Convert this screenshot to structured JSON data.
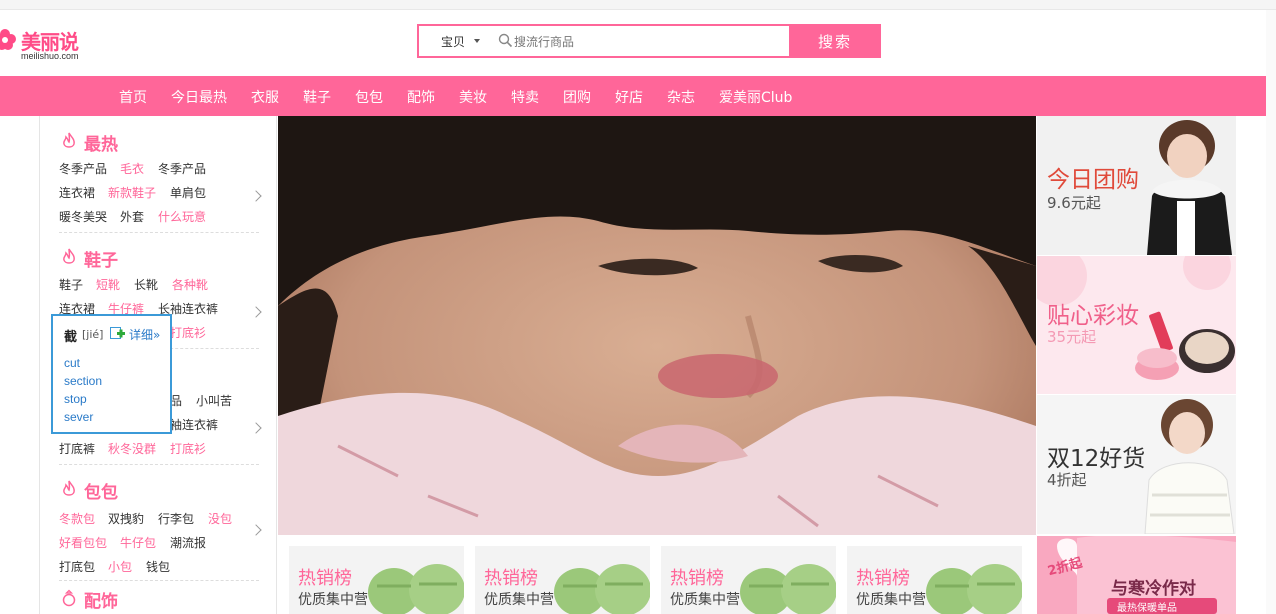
{
  "logo": {
    "name": "美丽说",
    "domain": "meilishuo.com"
  },
  "search": {
    "type_label": "宝贝",
    "placeholder": "搜流行商品",
    "button_label": "搜索"
  },
  "nav": [
    "首页",
    "今日最热",
    "衣服",
    "鞋子",
    "包包",
    "配饰",
    "美妆",
    "特卖",
    "团购",
    "好店",
    "杂志",
    "爱美丽Club"
  ],
  "sidebar": {
    "categories": [
      {
        "title": "最热",
        "rows": [
          [
            {
              "text": "冬季产品",
              "hot": false
            },
            {
              "text": "毛衣",
              "hot": true
            },
            {
              "text": "冬季产品",
              "hot": false
            }
          ],
          [
            {
              "text": "连衣裙",
              "hot": false
            },
            {
              "text": "新款鞋子",
              "hot": true
            },
            {
              "text": "单肩包",
              "hot": false
            }
          ],
          [
            {
              "text": "暖冬美哭",
              "hot": false
            },
            {
              "text": "外套",
              "hot": false
            },
            {
              "text": "什么玩意",
              "hot": true
            }
          ]
        ]
      },
      {
        "title": "鞋子",
        "rows": [
          [
            {
              "text": "鞋子",
              "hot": false
            },
            {
              "text": "短靴",
              "hot": true
            },
            {
              "text": "长靴",
              "hot": false
            },
            {
              "text": "各种靴",
              "hot": true
            }
          ],
          [
            {
              "text": "连衣裙",
              "hot": false
            },
            {
              "text": "牛仔裤",
              "hot": true
            },
            {
              "text": "长袖连衣裤",
              "hot": false
            }
          ],
          [
            {
              "text": "打底衫",
              "hot": true
            }
          ]
        ]
      },
      {
        "title": "",
        "rows": [
          [
            {
              "text": "品",
              "hot": false
            },
            {
              "text": "小叫苦",
              "hot": false
            }
          ],
          [
            {
              "text": "袖连衣裤",
              "hot": false
            }
          ],
          [
            {
              "text": "打底裤",
              "hot": false
            },
            {
              "text": "秋冬没群",
              "hot": true
            },
            {
              "text": "打底衫",
              "hot": true
            }
          ]
        ]
      },
      {
        "title": "包包",
        "rows": [
          [
            {
              "text": "冬款包",
              "hot": true
            },
            {
              "text": "双拽豹",
              "hot": false
            },
            {
              "text": "行李包",
              "hot": false
            },
            {
              "text": "没包",
              "hot": true
            }
          ],
          [
            {
              "text": "好看包包",
              "hot": true
            },
            {
              "text": "牛仔包",
              "hot": true
            },
            {
              "text": "潮流报",
              "hot": false
            }
          ],
          [
            {
              "text": "打底包",
              "hot": false
            },
            {
              "text": "小包",
              "hot": true
            },
            {
              "text": "钱包",
              "hot": false
            }
          ]
        ]
      },
      {
        "title": "配饰",
        "rows": []
      }
    ]
  },
  "dict": {
    "word": "截",
    "pron": "[jié]",
    "more": "详细»",
    "defs": [
      "cut",
      "section",
      "stop",
      "sever"
    ]
  },
  "banners": [
    {
      "title": "今日团购",
      "sub": "9.6元起"
    },
    {
      "title": "贴心彩妆",
      "sub": "35元起"
    },
    {
      "title": "双12好货",
      "sub": "4折起"
    },
    {
      "badge": "2折起",
      "title": "与寒冷作对",
      "sub": "最热保暖单品"
    }
  ],
  "cards": [
    {
      "title": "热销榜",
      "sub": "优质集中营"
    },
    {
      "title": "热销榜",
      "sub": "优质集中营"
    },
    {
      "title": "热销榜",
      "sub": "优质集中营"
    },
    {
      "title": "热销榜",
      "sub": "优质集中营"
    }
  ],
  "colors": {
    "brand": "#ff6699",
    "link": "#2a7ac8"
  }
}
